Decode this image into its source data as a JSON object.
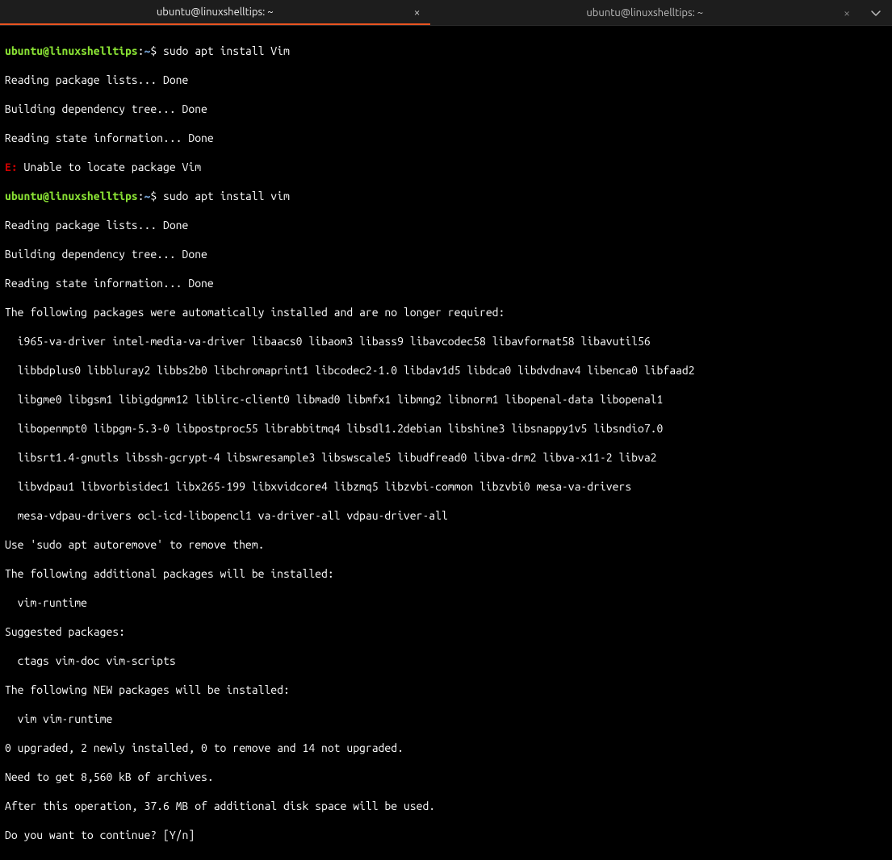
{
  "tabs": [
    {
      "title": "ubuntu@linuxshelltips: ~",
      "active": true
    },
    {
      "title": "ubuntu@linuxshelltips: ~",
      "active": false
    }
  ],
  "ps": {
    "user": "ubuntu@linuxshelltips",
    "sep": ":",
    "path": "~",
    "dollar": "$ "
  },
  "cmd1": "sudo apt install Vim",
  "out1a": "Reading package lists... Done",
  "out1b": "Building dependency tree... Done",
  "out1c": "Reading state information... Done",
  "err_tag": "E:",
  "err_msg": " Unable to locate package Vim",
  "cmd2": "sudo apt install vim",
  "out2a": "Reading package lists... Done",
  "out2b": "Building dependency tree... Done",
  "out2c": "Reading state information... Done",
  "auto_hdr": "The following packages were automatically installed and are no longer required:",
  "auto1": "  i965-va-driver intel-media-va-driver libaacs0 libaom3 libass9 libavcodec58 libavformat58 libavutil56",
  "auto2": "  libbdplus0 libbluray2 libbs2b0 libchromaprint1 libcodec2-1.0 libdav1d5 libdca0 libdvdnav4 libenca0 libfaad2",
  "auto3": "  libgme0 libgsm1 libigdgmm12 liblirc-client0 libmad0 libmfx1 libmng2 libnorm1 libopenal-data libopenal1",
  "auto4": "  libopenmpt0 libpgm-5.3-0 libpostproc55 librabbitmq4 libsdl1.2debian libshine3 libsnappy1v5 libsndio7.0",
  "auto5": "  libsrt1.4-gnutls libssh-gcrypt-4 libswresample3 libswscale5 libudfread0 libva-drm2 libva-x11-2 libva2",
  "auto6": "  libvdpau1 libvorbisidec1 libx265-199 libxvidcore4 libzmq5 libzvbi-common libzvbi0 mesa-va-drivers",
  "auto7": "  mesa-vdpau-drivers ocl-icd-libopencl1 va-driver-all vdpau-driver-all",
  "auto_hint": "Use 'sudo apt autoremove' to remove them.",
  "addl_hdr": "The following additional packages will be installed:",
  "addl1": "  vim-runtime",
  "sugg_hdr": "Suggested packages:",
  "sugg1": "  ctags vim-doc vim-scripts",
  "new_hdr": "The following NEW packages will be installed:",
  "new1": "  vim vim-runtime",
  "summary": "0 upgraded, 2 newly installed, 0 to remove and 14 not upgraded.",
  "need": "Need to get 8,560 kB of archives.",
  "after": "After this operation, 37.6 MB of additional disk space will be used.",
  "prompt": "Do you want to continue? [Y/n] "
}
